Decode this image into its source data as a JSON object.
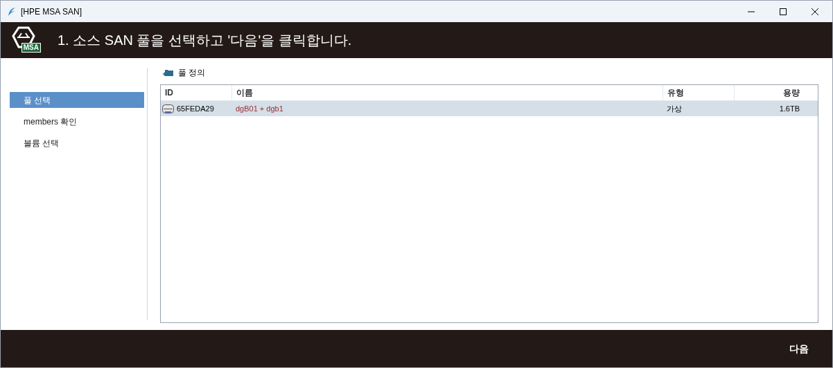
{
  "window": {
    "title": "[HPE MSA SAN]"
  },
  "header": {
    "logo_text": "MSA",
    "instruction": "1. 소스 SAN 풀을 선택하고 '다음'을 클릭합니다."
  },
  "sidebar": {
    "items": [
      {
        "label": "풀 선택",
        "selected": true
      },
      {
        "label": "members 확인",
        "selected": false
      },
      {
        "label": "볼륨 선택",
        "selected": false
      }
    ]
  },
  "section": {
    "title": "풀 정의"
  },
  "table": {
    "columns": [
      "ID",
      "이름",
      "유형",
      "용량"
    ],
    "rows": [
      {
        "selected": true,
        "cells": [
          "65FEDA29",
          "dgB01 + dgb1",
          "가상",
          "1.6TB"
        ]
      }
    ]
  },
  "footer": {
    "buttons": [
      "다음"
    ]
  }
}
